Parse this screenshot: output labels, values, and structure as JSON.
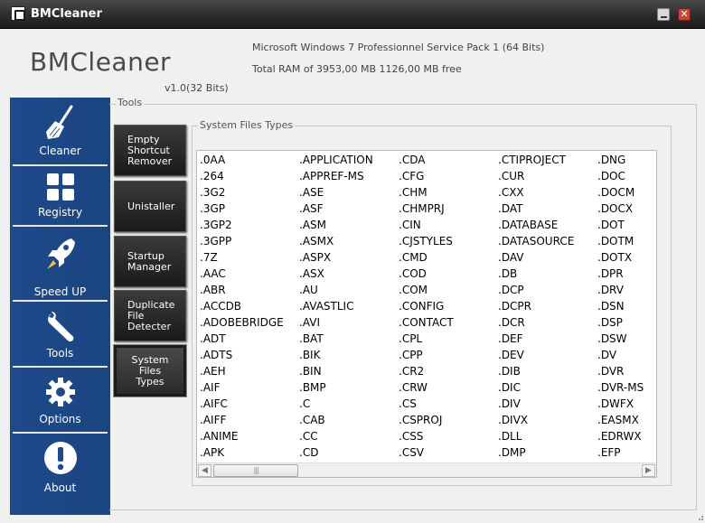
{
  "window": {
    "title": "BMCleaner",
    "close_glyph": "✕"
  },
  "header": {
    "app_name": "BMCleaner",
    "version": "v1.0(32 Bits)",
    "os_info": "Microsoft Windows 7 Professionnel Service Pack 1 (64 Bits)",
    "ram_info": "Total RAM of 3953,00 MB 1126,00 MB free"
  },
  "sidebar": {
    "items": [
      {
        "label": "Cleaner",
        "icon": "broom-icon"
      },
      {
        "label": "Registry",
        "icon": "grid-icon"
      },
      {
        "label": "Speed UP",
        "icon": "rocket-icon"
      },
      {
        "label": "Tools",
        "icon": "wrench-icon"
      },
      {
        "label": "Options",
        "icon": "gear-icon"
      },
      {
        "label": "About",
        "icon": "exclamation-icon"
      }
    ]
  },
  "tools": {
    "group_label": "Tools",
    "buttons": [
      {
        "label": "Empty Shortcut Remover"
      },
      {
        "label": "Unistaller"
      },
      {
        "label": "Startup Manager"
      },
      {
        "label": "Duplicate File Detecter"
      },
      {
        "label": "System Files Types",
        "active": true
      }
    ]
  },
  "system_files": {
    "group_label": "System Files Types",
    "columns": [
      [
        ".0AA",
        ".264",
        ".3G2",
        ".3GP",
        ".3GP2",
        ".3GPP",
        ".7Z",
        ".AAC",
        ".ABR",
        ".ACCDB",
        ".ADOBEBRIDGE",
        ".ADT",
        ".ADTS",
        ".AEH",
        ".AIF",
        ".AIFC",
        ".AIFF",
        ".ANIME",
        ".APK"
      ],
      [
        ".APPLICATION",
        ".APPREF-MS",
        ".ASE",
        ".ASF",
        ".ASM",
        ".ASMX",
        ".ASPX",
        ".ASX",
        ".AU",
        ".AVASTLIC",
        ".AVI",
        ".BAT",
        ".BIK",
        ".BIN",
        ".BMP",
        ".C",
        ".CAB",
        ".CC",
        ".CD"
      ],
      [
        ".CDA",
        ".CFG",
        ".CHM",
        ".CHMPRJ",
        ".CIN",
        ".CJSTYLES",
        ".CMD",
        ".COD",
        ".COM",
        ".CONFIG",
        ".CONTACT",
        ".CPL",
        ".CPP",
        ".CR2",
        ".CRW",
        ".CS",
        ".CSPROJ",
        ".CSS",
        ".CSV"
      ],
      [
        ".CTIPROJECT",
        ".CUR",
        ".CXX",
        ".DAT",
        ".DATABASE",
        ".DATASOURCE",
        ".DAV",
        ".DB",
        ".DCP",
        ".DCPR",
        ".DCR",
        ".DEF",
        ".DEV",
        ".DIB",
        ".DIC",
        ".DIV",
        ".DIVX",
        ".DLL",
        ".DMP"
      ],
      [
        ".DNG",
        ".DOC",
        ".DOCM",
        ".DOCX",
        ".DOT",
        ".DOTM",
        ".DOTX",
        ".DPR",
        ".DRV",
        ".DSN",
        ".DSP",
        ".DSW",
        ".DV",
        ".DVR",
        ".DVR-MS",
        ".DWFX",
        ".EASMX",
        ".EDRWX",
        ".EFP"
      ]
    ],
    "scroll": {
      "left_glyph": "◀",
      "right_glyph": "▶",
      "thumb_glyph": "|||"
    }
  }
}
